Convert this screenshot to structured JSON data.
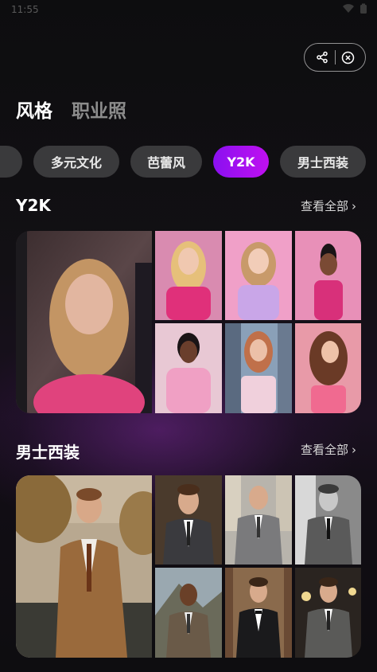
{
  "status": {
    "time": "11:55"
  },
  "header": {
    "share_icon": "share-icon",
    "close_icon": "close-circle-icon"
  },
  "tabs": [
    {
      "label": "风格",
      "active": true
    },
    {
      "label": "职业照",
      "active": false
    }
  ],
  "chips": [
    {
      "label": "多元文化",
      "active": false
    },
    {
      "label": "芭蕾风",
      "active": false
    },
    {
      "label": "Y2K",
      "active": true
    },
    {
      "label": "男士西装",
      "active": false
    }
  ],
  "sections": [
    {
      "title": "Y2K",
      "see_all": "查看全部",
      "palette": "pink"
    },
    {
      "title": "男士西装",
      "see_all": "查看全部",
      "palette": "suit"
    }
  ],
  "colors": {
    "accent_start": "#8a10f0",
    "accent_end": "#c010f0",
    "chip_bg": "#3a3a3c"
  }
}
